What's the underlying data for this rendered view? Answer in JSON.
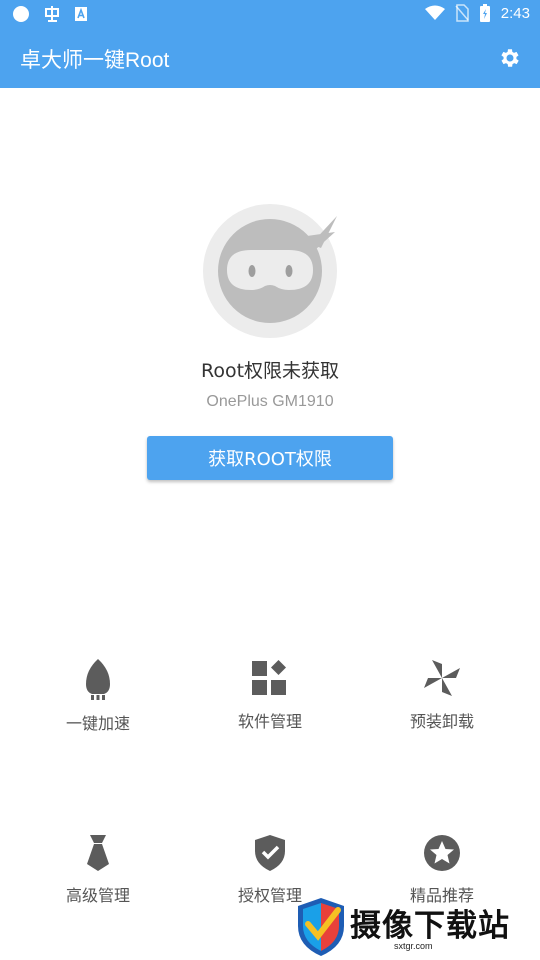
{
  "status_bar": {
    "time": "2:43",
    "left_icons": [
      "circle-notification-icon",
      "app-notification-icon",
      "text-notification-icon"
    ],
    "right_icons": [
      "wifi-icon",
      "no-sim-icon",
      "battery-icon"
    ]
  },
  "toolbar": {
    "title": "卓大师一键Root",
    "settings_icon": "gear-icon"
  },
  "main": {
    "status_title": "Root权限未获取",
    "device_name": "OnePlus GM1910",
    "root_button_label": "获取ROOT权限"
  },
  "tools": [
    {
      "label": "一键加速",
      "icon": "rocket-icon"
    },
    {
      "label": "软件管理",
      "icon": "apps-icon"
    },
    {
      "label": "预装卸载",
      "icon": "pinwheel-icon"
    },
    {
      "label": "高级管理",
      "icon": "necktie-icon"
    },
    {
      "label": "授权管理",
      "icon": "shield-check-icon"
    },
    {
      "label": "精品推荐",
      "icon": "star-icon"
    }
  ],
  "watermark": {
    "text": "摄像下载站",
    "url": "sxtgr.com"
  },
  "colors": {
    "primary": "#4da3ef",
    "icon_gray": "#5c5c5c",
    "avatar_gray": "#bdbdbd"
  }
}
